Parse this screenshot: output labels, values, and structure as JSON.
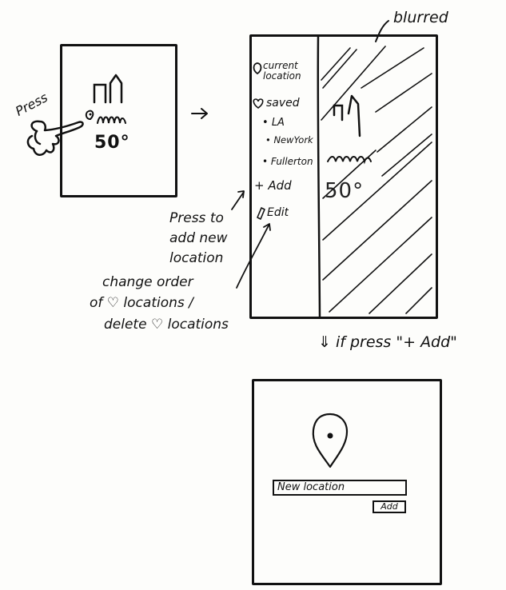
{
  "phone_home": {
    "press_label": "Press",
    "temperature": "50°"
  },
  "menu_panel": {
    "blurred_label": "blurred",
    "current_location_label": "current location",
    "saved_label": "saved",
    "saved_locations": [
      "LA",
      "NewYork",
      "Fullerton"
    ],
    "add_label": "+ Add",
    "edit_label": "Edit",
    "temperature": "50°"
  },
  "annotations": {
    "add_note_lines": [
      "Press to",
      "add new",
      "location"
    ],
    "edit_note_lines": [
      "change order",
      "of ♡ locations /",
      "delete ♡ locations"
    ],
    "transition_label": "⇓ if press \"+ Add\""
  },
  "add_screen": {
    "input_value": "New location",
    "add_button_label": "Add"
  }
}
